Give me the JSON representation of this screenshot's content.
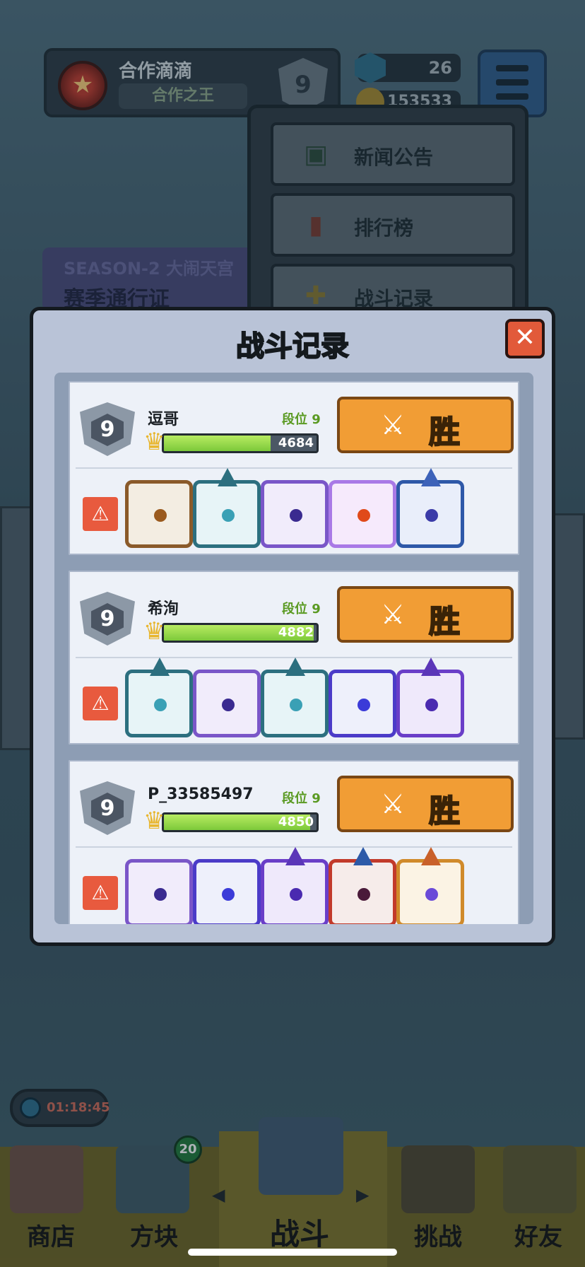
{
  "profile": {
    "name": "合作滴滴",
    "title": "合作之王",
    "rank": "9"
  },
  "currency": {
    "gems": "26",
    "coins": "153533"
  },
  "dropdown": {
    "items": [
      "新闻公告",
      "排行榜",
      "战斗记录"
    ]
  },
  "season": {
    "line1": "SEASON-2 大闹天宫",
    "line2": "赛季通行证"
  },
  "modal": {
    "title": "战斗记录",
    "close": "✕",
    "records": [
      {
        "rank": "9",
        "name": "逗哥",
        "rank_label": "段位 9",
        "score": "4684",
        "score_fraction": 0.7,
        "result": "胜"
      },
      {
        "rank": "9",
        "name": "希洵",
        "rank_label": "段位 9",
        "score": "4882",
        "score_fraction": 0.98,
        "result": "胜"
      },
      {
        "rank": "9",
        "name": "P_33585497",
        "rank_label": "段位 9",
        "score": "4850",
        "score_fraction": 0.96,
        "result": "胜"
      }
    ]
  },
  "timer": "01:18:45",
  "nav": {
    "shop": "商店",
    "blocks": "方块",
    "blocks_badge": "20",
    "battle": "战斗",
    "challenge": "挑战",
    "friends": "好友"
  },
  "colors": {
    "win_button": "#f19d35",
    "modal_bg": "#b9c3d7",
    "bar_fill": "#7cc93a",
    "close_button": "#e25a3a"
  }
}
